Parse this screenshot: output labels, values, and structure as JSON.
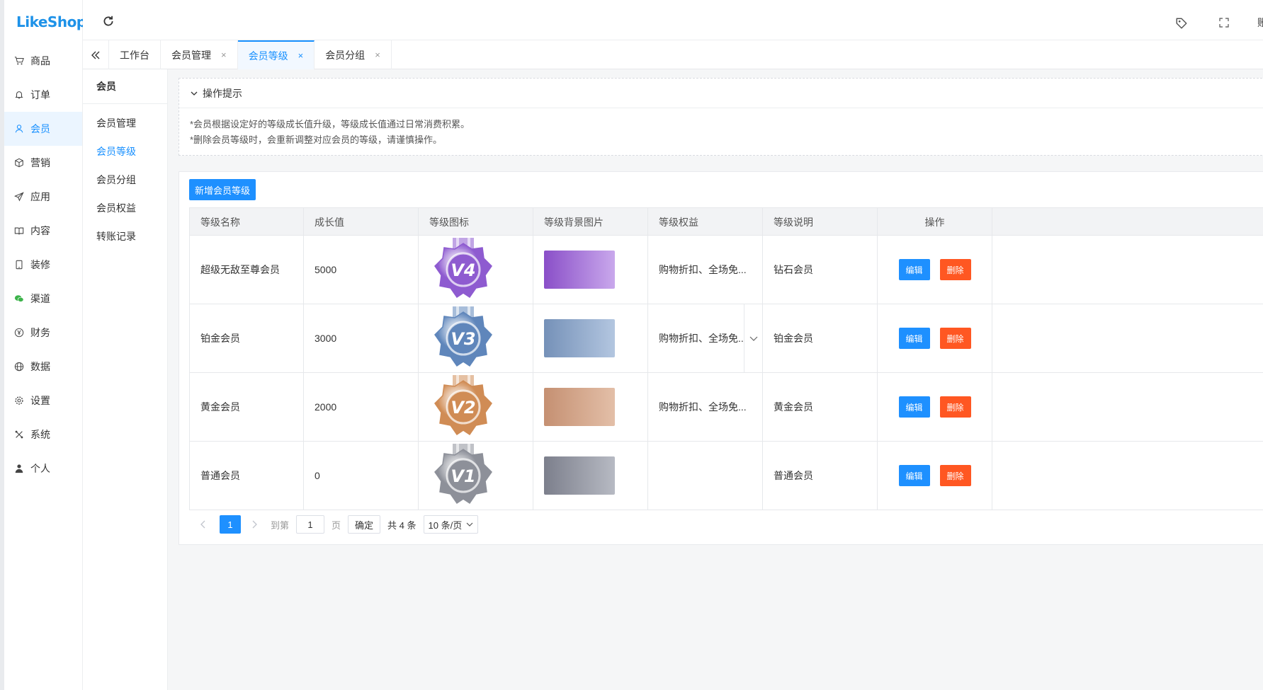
{
  "app": {
    "logo": "LikeShop"
  },
  "sidebar": {
    "items": [
      {
        "label": "商品",
        "icon": "cart-icon"
      },
      {
        "label": "订单",
        "icon": "bell-icon"
      },
      {
        "label": "会员",
        "icon": "user-icon",
        "active": true
      },
      {
        "label": "营销",
        "icon": "box-icon"
      },
      {
        "label": "应用",
        "icon": "send-icon"
      },
      {
        "label": "内容",
        "icon": "book-icon"
      },
      {
        "label": "装修",
        "icon": "tablet-icon"
      },
      {
        "label": "渠道",
        "icon": "wechat-icon"
      },
      {
        "label": "财务",
        "icon": "yen-icon"
      },
      {
        "label": "数据",
        "icon": "globe-icon"
      },
      {
        "label": "设置",
        "icon": "gear-icon"
      },
      {
        "label": "系统",
        "icon": "tools-icon"
      },
      {
        "label": "个人",
        "icon": "person-icon"
      }
    ]
  },
  "topbar": {
    "user_text": "账"
  },
  "tabs": [
    {
      "label": "工作台",
      "closable": false
    },
    {
      "label": "会员管理",
      "closable": true
    },
    {
      "label": "会员等级",
      "closable": true,
      "active": true
    },
    {
      "label": "会员分组",
      "closable": true
    }
  ],
  "subnav": {
    "title": "会员",
    "items": [
      {
        "label": "会员管理"
      },
      {
        "label": "会员等级",
        "active": true
      },
      {
        "label": "会员分组"
      },
      {
        "label": "会员权益"
      },
      {
        "label": "转账记录"
      }
    ]
  },
  "tips": {
    "title": "操作提示",
    "lines": [
      "*会员根据设定好的等级成长值升级，等级成长值通过日常消费积累。",
      "*删除会员等级时，会重新调整对应会员的等级，请谨慎操作。"
    ]
  },
  "toolbar": {
    "add_label": "新增会员等级"
  },
  "table": {
    "headers": [
      "等级名称",
      "成长值",
      "等级图标",
      "等级背景图片",
      "等级权益",
      "等级说明",
      "操作"
    ],
    "edit_label": "编辑",
    "delete_label": "删除",
    "rows": [
      {
        "name": "超级无敌至尊会员",
        "growth": "5000",
        "medal_text": "V4",
        "medal_color": "#8e5bd0",
        "bg_from": "#8a4fc8",
        "bg_to": "#c9a8ec",
        "benefits": "购物折扣、全场免...",
        "desc": "钻石会员"
      },
      {
        "name": "铂金会员",
        "growth": "3000",
        "medal_text": "V3",
        "medal_color": "#5f86bb",
        "bg_from": "#7591b8",
        "bg_to": "#b3c6e0",
        "benefits": "购物折扣、全场免...",
        "desc": "铂金会员",
        "hover": true
      },
      {
        "name": "黄金会员",
        "growth": "2000",
        "medal_text": "V2",
        "medal_color": "#d08c55",
        "bg_from": "#c59072",
        "bg_to": "#e3bfa8",
        "benefits": "购物折扣、全场免...",
        "desc": "黄金会员"
      },
      {
        "name": "普通会员",
        "growth": "0",
        "medal_text": "V1",
        "medal_color": "#8d9099",
        "bg_from": "#7c7f8c",
        "bg_to": "#b7bac3",
        "benefits": "",
        "desc": "普通会员"
      }
    ]
  },
  "pagination": {
    "current": "1",
    "goto_label": "到第",
    "goto_value": "1",
    "page_label": "页",
    "confirm_label": "确定",
    "total_label": "共 4 条",
    "page_size_label": "10 条/页"
  }
}
